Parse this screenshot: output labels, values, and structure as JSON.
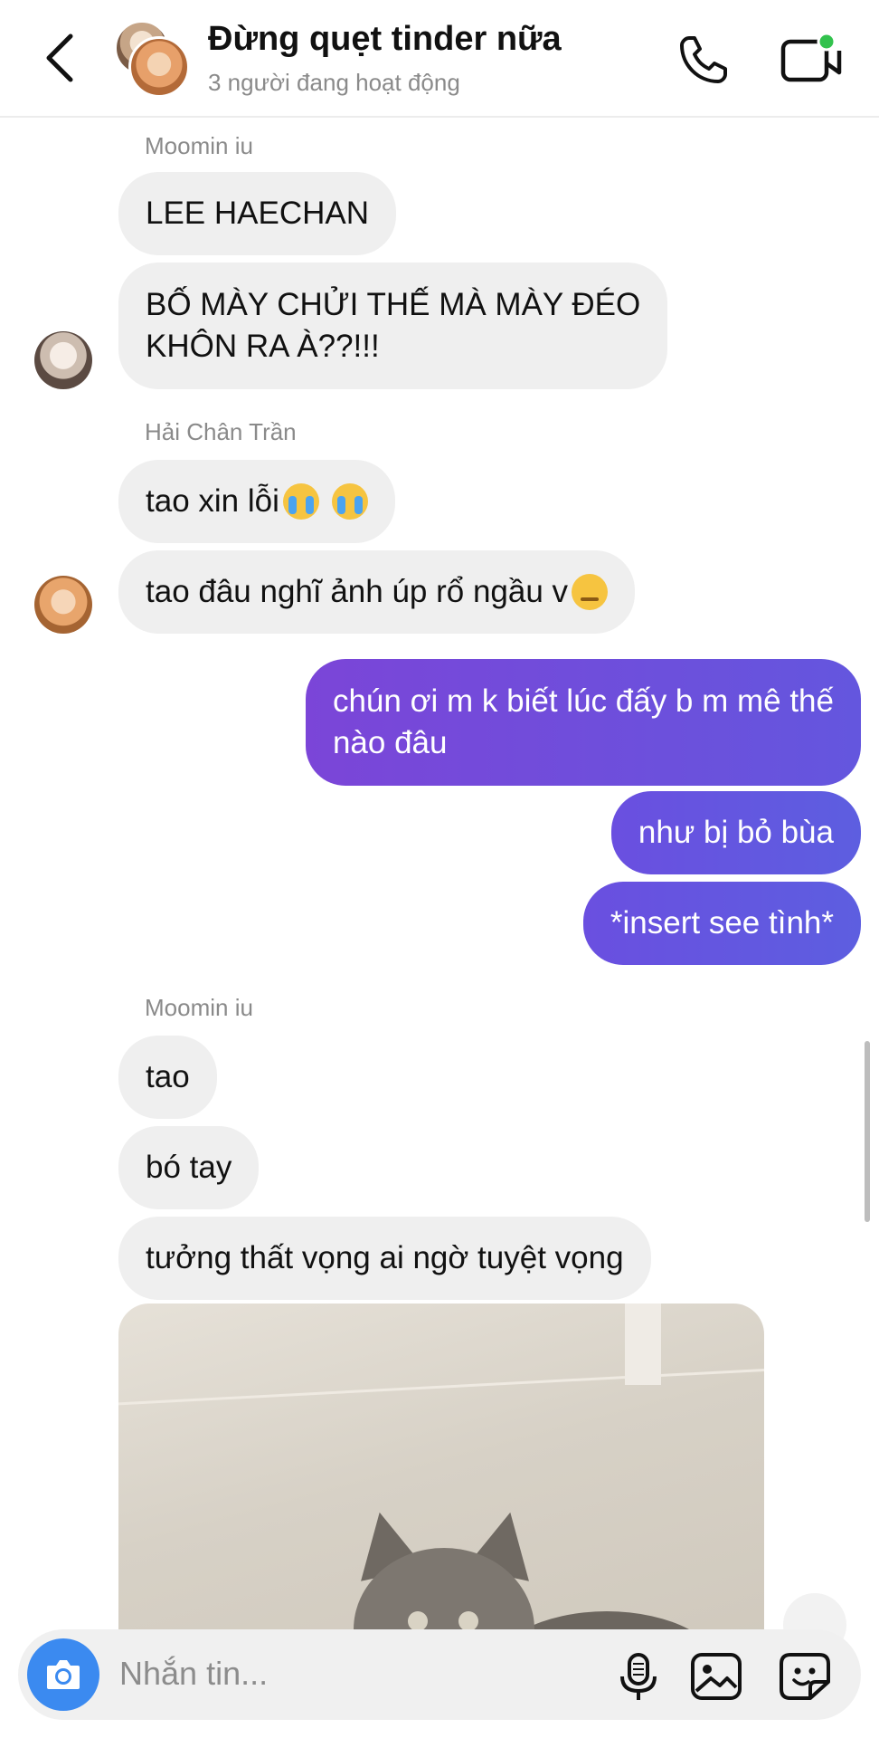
{
  "header": {
    "title": "Đừng quẹt tinder nữa",
    "subtitle": "3 người đang hoạt động",
    "online_color": "#32c24d"
  },
  "messages": [
    {
      "type": "sender",
      "text": "Moomin iu"
    },
    {
      "type": "in",
      "text": "LEE HAECHAN"
    },
    {
      "type": "in",
      "text": "BỐ MÀY CHỬI THẾ MÀ MÀY ĐÉO\nKHÔN RA À??!!!"
    },
    {
      "type": "sender",
      "text": "Hải Chân Trần"
    },
    {
      "type": "in",
      "text": "tao xin lỗi",
      "emoji": [
        "loudly-crying-face",
        "loudly-crying-face"
      ]
    },
    {
      "type": "in",
      "text": "tao đâu nghĩ ảnh úp rổ ngầu v",
      "emoji": [
        "pensive-face"
      ]
    },
    {
      "type": "out",
      "text": "chún ơi m k biết lúc đấy b m mê thế\nnào đâu"
    },
    {
      "type": "out",
      "text": "như bị bỏ bùa"
    },
    {
      "type": "out",
      "text": "*insert see tình*"
    },
    {
      "type": "sender",
      "text": "Moomin iu"
    },
    {
      "type": "in",
      "text": "tao"
    },
    {
      "type": "in",
      "text": "bó tay"
    },
    {
      "type": "in",
      "text": "tưởng thất vọng ai ngờ tuyệt vọng"
    },
    {
      "type": "image",
      "subject": "cat"
    }
  ],
  "composer": {
    "placeholder": "Nhắn tin..."
  },
  "colors": {
    "outgoing": "#6356df",
    "incoming": "#efefef",
    "camera": "#3b8af0"
  }
}
